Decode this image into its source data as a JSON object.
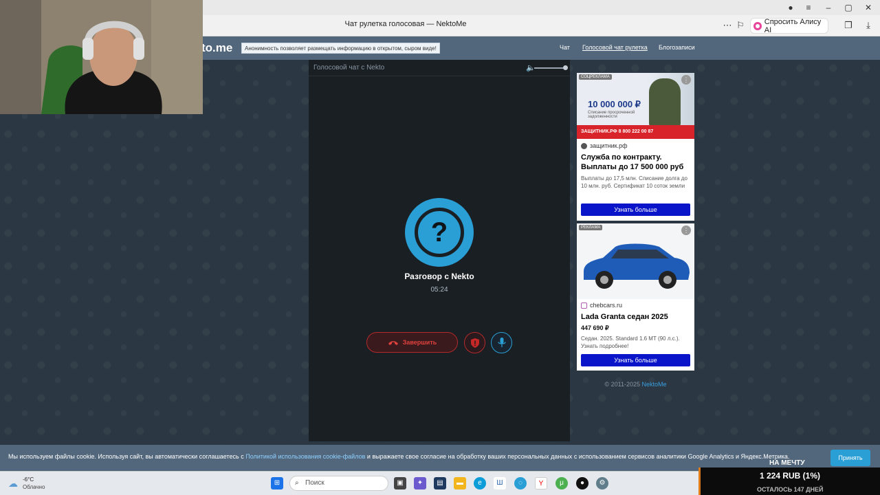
{
  "browser": {
    "tab_title": "Чат рулетка голосовая — NektoMe",
    "alice_label": "Спросить Алису AI"
  },
  "site": {
    "logo_text": "to.me",
    "notice": "Анонимность позволяет размещать информацию в открытом, сыром виде!",
    "nav": [
      "Чат",
      "Голосовой чат рулетка",
      "Блогозаписи"
    ]
  },
  "chat": {
    "panel_title": "Голосовой чат с Nekto",
    "conversation_name": "Разговор с Nekto",
    "timer": "05:24",
    "end_label": "Завершить",
    "avatar_symbol": "?"
  },
  "ads": [
    {
      "tag": "СОЦРЕКЛАМА",
      "image_amount": "10 000 000 ₽",
      "image_sub": "Списание просроченной задолженности",
      "image_footer": "ЗАЩИТНИК.РФ  8 800 222 00 87",
      "domain": "защитник.рф",
      "headline": "Служба по контракту. Выплаты до 17 500 000 руб",
      "body": "Выплаты до 17,5 млн. Списание долга до 10 млн. руб. Сертификат 10 соток земли",
      "button": "Узнать больше"
    },
    {
      "tag": "РЕКЛАМА",
      "domain": "chebcars.ru",
      "headline": "Lada Granta седан 2025",
      "price": "447 690 ₽",
      "body": "Седан. 2025. Standard 1.6 MT (90 л.с.). Узнать подробнее!",
      "button": "Узнать больше"
    }
  ],
  "copyright": {
    "text": "© 2011-2025",
    "link": "NektoMe"
  },
  "cookie": {
    "text_before": "Мы используем файлы cookie. Используя сайт, вы автоматически соглашаетесь с",
    "link": "Политикой использования cookie-файлов",
    "text_after": "и выражаете свое согласие на обработку ваших персональных данных с использованием сервисов аналитики Google Analytics и Яндекс.Метрика.",
    "accept": "Принять"
  },
  "taskbar": {
    "temperature": "-6°C",
    "condition": "Облачно",
    "search_placeholder": "Поиск"
  },
  "donation": {
    "goal": "НА МЕЧТУ",
    "amount": "1 224 RUB (1%)",
    "remaining": "ОСТАЛОСЬ 147 ДНЕЙ"
  },
  "colors": {
    "accent": "#2a9fd6",
    "danger": "#e0413c",
    "header": "#52677b",
    "ad_button": "#0a14c8"
  }
}
